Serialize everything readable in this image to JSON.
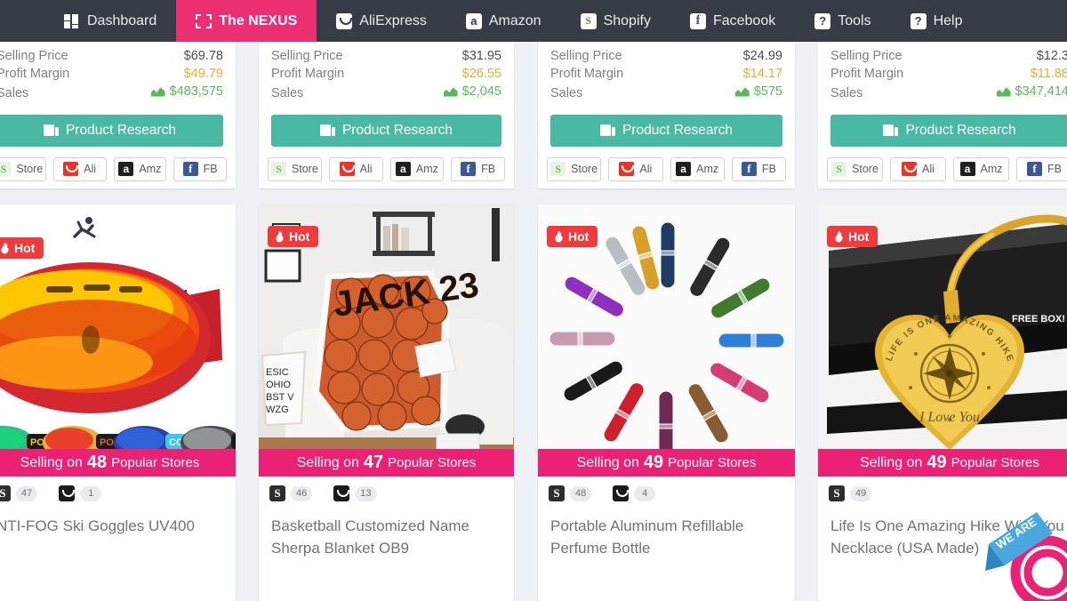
{
  "navbar": {
    "items": [
      {
        "label": "Dashboard",
        "icon": "dashboard-grid-icon",
        "active": false
      },
      {
        "label": "The NEXUS",
        "icon": "nexus-corners-icon",
        "active": true
      },
      {
        "label": "AliExpress",
        "icon": "aliexpress-icon",
        "active": false
      },
      {
        "label": "Amazon",
        "icon": "amazon-icon",
        "active": false
      },
      {
        "label": "Shopify",
        "icon": "shopify-icon",
        "active": false
      },
      {
        "label": "Facebook",
        "icon": "facebook-icon",
        "active": false
      },
      {
        "label": "Tools",
        "icon": "question-mark-icon",
        "active": false
      },
      {
        "label": "Help",
        "icon": "question-mark-icon",
        "active": false
      }
    ],
    "background_color": "#363c46",
    "active_color": "#eb2f72"
  },
  "stat_labels": {
    "selling_price": "Selling Price",
    "profit_margin": "Profit Margin",
    "sales": "Sales"
  },
  "buttons": {
    "product_research": "Product Research",
    "store": "Store",
    "ali": "Ali",
    "amz": "Amz",
    "fb": "FB"
  },
  "colors": {
    "accent_pink": "#eb2176",
    "teal_button": "#4ab9a4",
    "margin_orange": "#f0ad2e",
    "sales_green": "#5cb85c",
    "hot_red": "#ef3b3b"
  },
  "top_cards": [
    {
      "selling_price": "$69.78",
      "profit_margin": "$49.79",
      "sales": "$483,575"
    },
    {
      "selling_price": "$31.95",
      "profit_margin": "$26.55",
      "sales": "$2,045"
    },
    {
      "selling_price": "$24.99",
      "profit_margin": "$14.17",
      "sales": "$575"
    },
    {
      "selling_price": "$12.3",
      "profit_margin": "$11.88",
      "sales": "$347,414"
    }
  ],
  "bottom_cards": [
    {
      "hot_label": "Hot",
      "banner_prefix": "Selling on",
      "store_count": "48",
      "banner_suffix": "Popular Stores",
      "platforms": [
        {
          "icon": "shopify-icon",
          "count": "47"
        },
        {
          "icon": "aliexpress-icon",
          "count": "1"
        }
      ],
      "title": "NTI-FOG Ski Goggles UV400",
      "image_alt": "ski-goggles"
    },
    {
      "hot_label": "Hot",
      "banner_prefix": "Selling on",
      "store_count": "47",
      "banner_suffix": "Popular Stores",
      "platforms": [
        {
          "icon": "shopify-icon",
          "count": "46"
        },
        {
          "icon": "aliexpress-icon",
          "count": "13"
        }
      ],
      "title": "Basketball Customized Name Sherpa Blanket OB9",
      "image_alt": "basketball-sherpa-blanket"
    },
    {
      "hot_label": "Hot",
      "banner_prefix": "Selling on",
      "store_count": "49",
      "banner_suffix": "Popular Stores",
      "platforms": [
        {
          "icon": "shopify-icon",
          "count": "48"
        },
        {
          "icon": "aliexpress-icon",
          "count": "4"
        }
      ],
      "title": "Portable Aluminum Refillable Perfume Bottle",
      "image_alt": "perfume-atomizers"
    },
    {
      "hot_label": "Hot",
      "banner_prefix": "Selling on",
      "store_count": "49",
      "banner_suffix": "Popular Stores",
      "platforms": [
        {
          "icon": "shopify-icon",
          "count": "49"
        }
      ],
      "title": "Life Is One Amazing Hike With You Necklace (USA Made)",
      "image_alt": "gold-heart-necklace",
      "overlay_ribbon_text": "WE ARE",
      "image_caption": "FREE BOX!"
    }
  ]
}
